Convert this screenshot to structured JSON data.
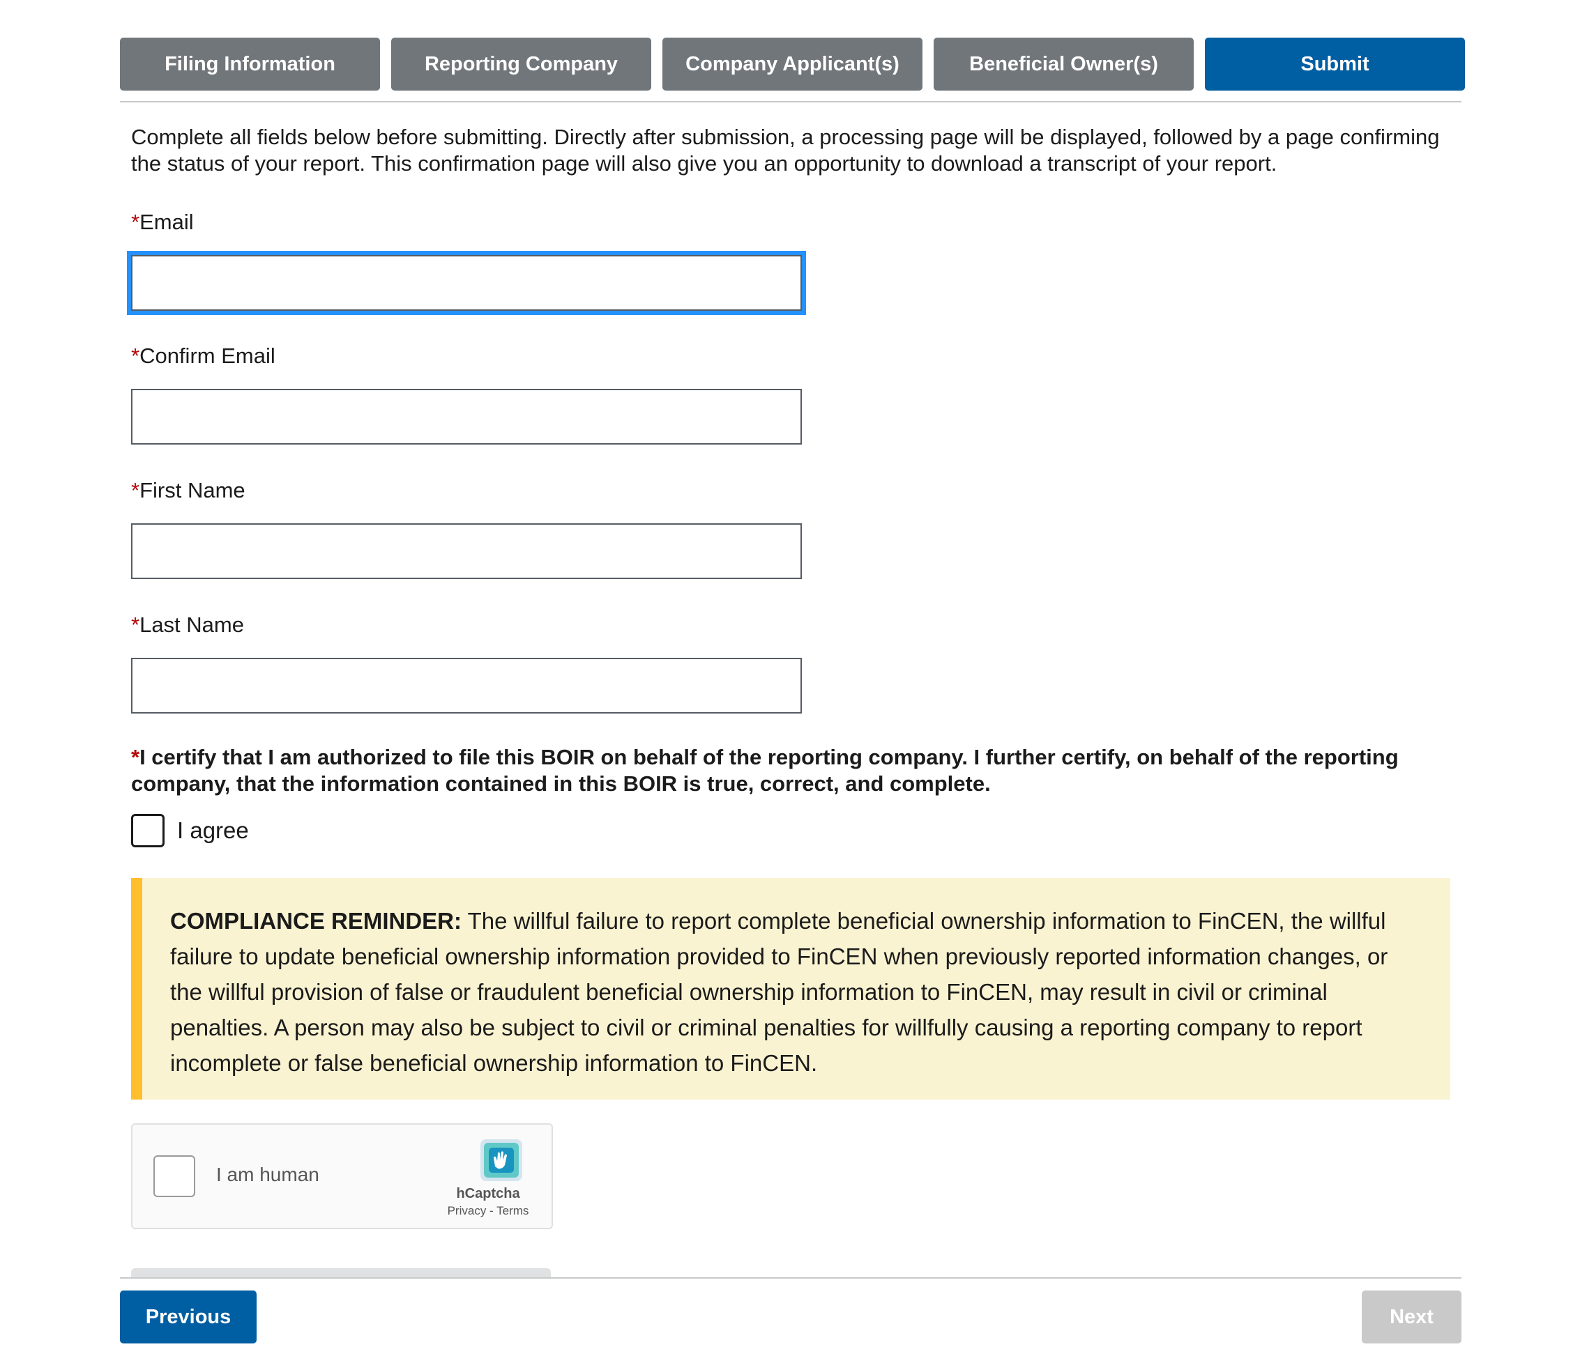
{
  "tabs": [
    {
      "label": "Filing Information"
    },
    {
      "label": "Reporting Company"
    },
    {
      "label": "Company Applicant(s)"
    },
    {
      "label": "Beneficial Owner(s)"
    },
    {
      "label": "Submit"
    }
  ],
  "intro": "Complete all fields below before submitting. Directly after submission, a processing page will be displayed, followed by a page confirming the status of your report. This confirmation page will also give you an opportunity to download a transcript of your report.",
  "required_mark": "*",
  "fields": {
    "email": {
      "label": "Email",
      "value": ""
    },
    "confirm_email": {
      "label": "Confirm Email",
      "value": ""
    },
    "first_name": {
      "label": "First Name",
      "value": ""
    },
    "last_name": {
      "label": "Last Name",
      "value": ""
    }
  },
  "certify": "I certify that I am authorized to file this BOIR on behalf of the reporting company. I further certify, on behalf of the reporting company, that the information contained in this BOIR is true, correct, and complete.",
  "agree_label": "I agree",
  "compliance": {
    "heading": "COMPLIANCE REMINDER:",
    "body": " The willful failure to report complete beneficial ownership information to FinCEN, the willful failure to update beneficial ownership information provided to FinCEN when previously reported information changes, or the willful provision of false or fraudulent beneficial ownership information to FinCEN, may result in civil or criminal penalties. A person may also be subject to civil or criminal penalties for willfully causing a reporting company to report incomplete or false beneficial ownership information to FinCEN."
  },
  "captcha": {
    "label": "I am human",
    "brand": "hCaptcha",
    "links": "Privacy - Terms"
  },
  "nav": {
    "previous": "Previous",
    "next": "Next"
  },
  "colors": {
    "primary": "#005ea2",
    "tab_inactive": "#71767a",
    "focus": "#2491ff",
    "required": "#b50909",
    "alert_bg": "#faf3d1",
    "alert_border": "#ffbe2e",
    "disabled": "#c9c9c9"
  }
}
